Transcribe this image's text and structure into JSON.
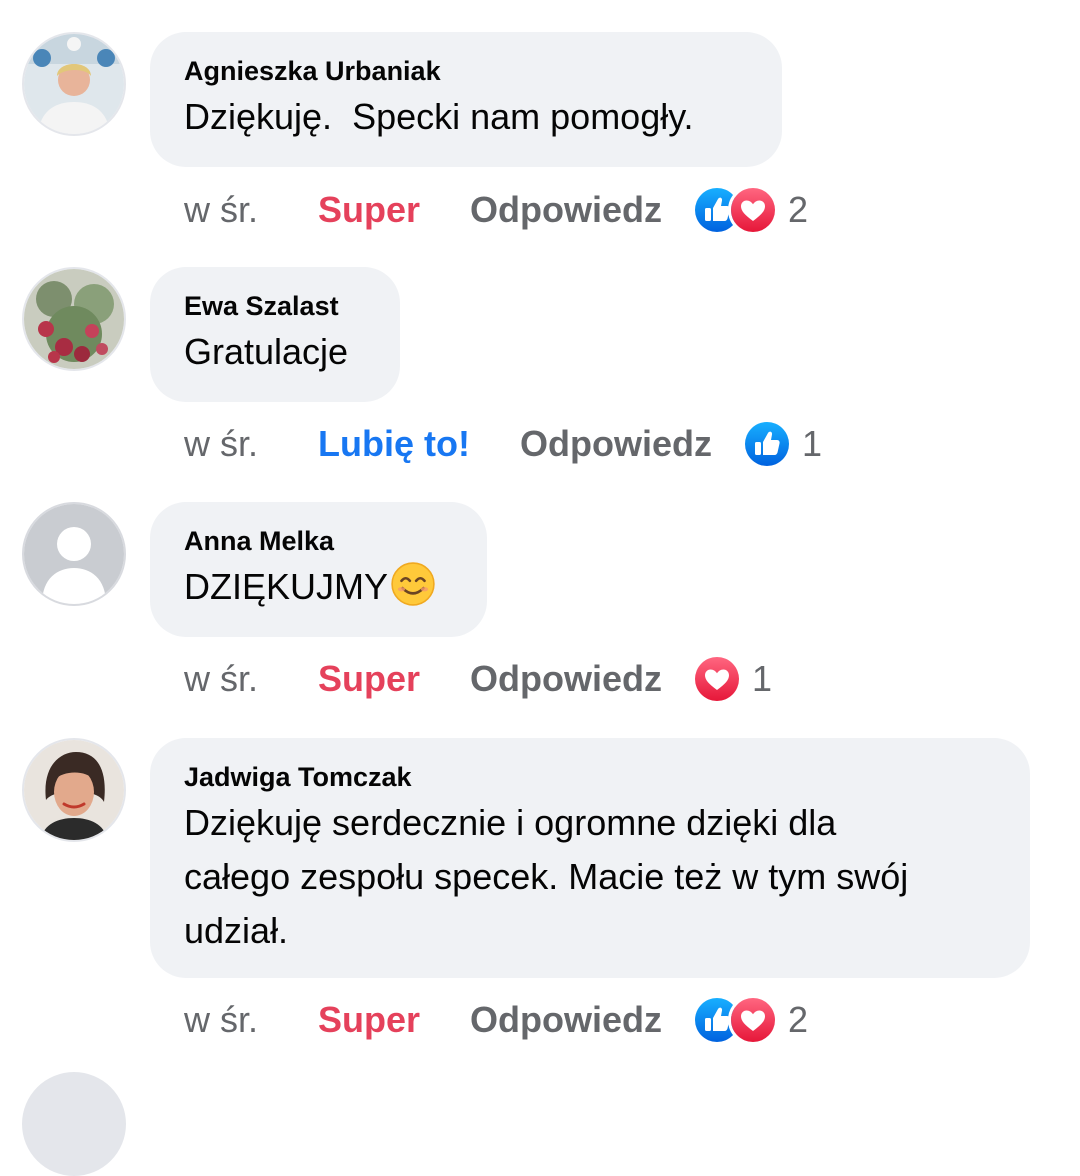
{
  "comments": [
    {
      "author": "Agnieszka Urbaniak",
      "text": "Dziękuję.  Specki nam pomogły.",
      "time": "w śr.",
      "reaction_label": "Super",
      "reply_label": "Odpowiedz",
      "reactions": [
        "like-icon",
        "heart-icon"
      ],
      "reaction_count": "2"
    },
    {
      "author": "Ewa Szalast",
      "text": "Gratulacje",
      "time": "w śr.",
      "reaction_label": "Lubię to!",
      "reply_label": "Odpowiedz",
      "reactions": [
        "like-icon"
      ],
      "reaction_count": "1"
    },
    {
      "author": "Anna Melka",
      "text": "DZIĘKUJMY",
      "text_emoji": "smiling-face-emoji",
      "time": "w śr.",
      "reaction_label": "Super",
      "reply_label": "Odpowiedz",
      "reactions": [
        "heart-icon"
      ],
      "reaction_count": "1"
    },
    {
      "author": "Jadwiga Tomczak",
      "text_lines": [
        "Dziękuję serdecznie i ogromne dzięki dla",
        "całego zespołu specek. Macie też w tym swój",
        "udział."
      ],
      "time": "w śr.",
      "reaction_label": "Super",
      "reply_label": "Odpowiedz",
      "reactions": [
        "like-icon",
        "heart-icon"
      ],
      "reaction_count": "2"
    }
  ],
  "colors": {
    "bubble": "#f0f2f5",
    "meta_gray": "#65676b",
    "super": "#e5415b",
    "like": "#1877f2",
    "heart": "#f02849"
  }
}
